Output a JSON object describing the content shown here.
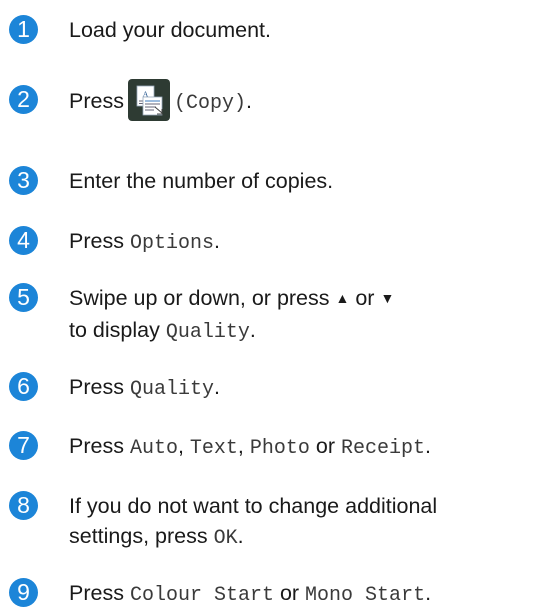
{
  "steps": [
    {
      "num": "1",
      "parts": [
        {
          "t": "Load your document."
        }
      ]
    },
    {
      "num": "2",
      "parts": [
        {
          "t": "Press"
        },
        {
          "icon": "copy-icon"
        },
        {
          "m": "(Copy)"
        },
        {
          "t": "."
        }
      ]
    },
    {
      "num": "3",
      "parts": [
        {
          "t": "Enter the number of copies."
        }
      ]
    },
    {
      "num": "4",
      "parts": [
        {
          "t": "Press "
        },
        {
          "m": "Options"
        },
        {
          "t": "."
        }
      ]
    },
    {
      "num": "5",
      "parts": [
        {
          "t": "Swipe up or down, or press "
        },
        {
          "tri": "▲"
        },
        {
          "t": " or "
        },
        {
          "tri": "▼"
        },
        {
          "t": " to display "
        },
        {
          "m": "Quality"
        },
        {
          "t": "."
        }
      ]
    },
    {
      "num": "6",
      "parts": [
        {
          "t": "Press "
        },
        {
          "m": "Quality"
        },
        {
          "t": "."
        }
      ]
    },
    {
      "num": "7",
      "parts": [
        {
          "t": "Press "
        },
        {
          "m": "Auto"
        },
        {
          "t": ", "
        },
        {
          "m": "Text"
        },
        {
          "t": ", "
        },
        {
          "m": "Photo"
        },
        {
          "t": " or "
        },
        {
          "m": "Receipt"
        },
        {
          "t": "."
        }
      ]
    },
    {
      "num": "8",
      "parts": [
        {
          "t": "If you do not want to change additional settings, press "
        },
        {
          "m": "OK"
        },
        {
          "t": "."
        }
      ]
    },
    {
      "num": "9",
      "parts": [
        {
          "t": "Press "
        },
        {
          "m": "Colour Start"
        },
        {
          "t": " or "
        },
        {
          "m": "Mono Start"
        },
        {
          "t": "."
        }
      ]
    }
  ],
  "colors": {
    "step_badge": "#1c85d8",
    "copy_icon_bg": "#2e3b33"
  }
}
